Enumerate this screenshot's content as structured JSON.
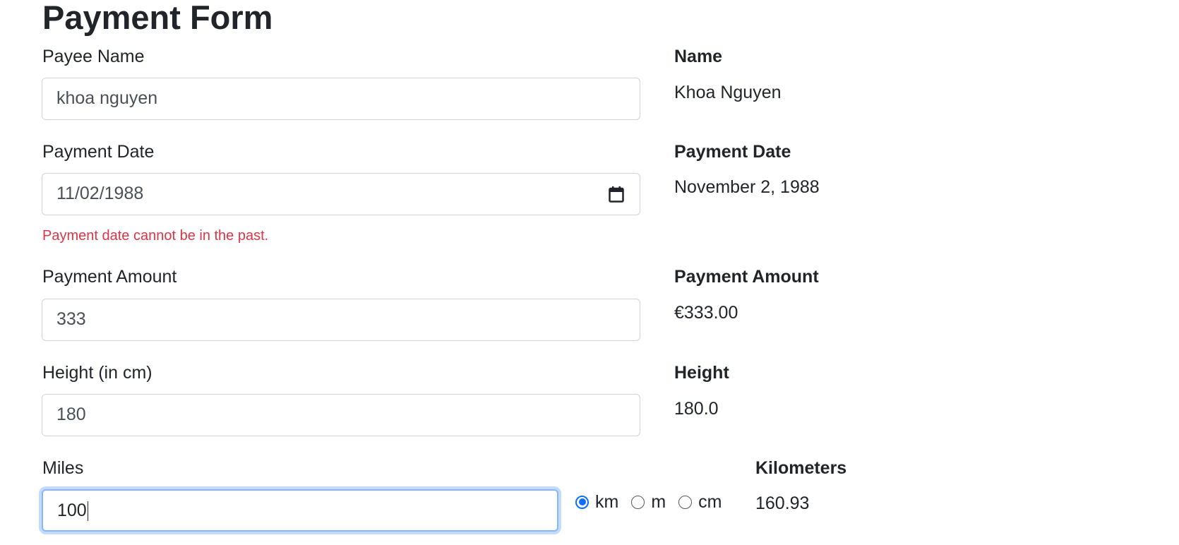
{
  "form": {
    "title": "Payment Form",
    "payee_name": {
      "label": "Payee Name",
      "value": "khoa nguyen"
    },
    "payment_date": {
      "label": "Payment Date",
      "value": "11/02/1988",
      "error": "Payment date cannot be in the past."
    },
    "payment_amount": {
      "label": "Payment Amount",
      "value": "333"
    },
    "height": {
      "label": "Height (in cm)",
      "value": "180"
    },
    "miles": {
      "label": "Miles",
      "value": "100",
      "units": [
        {
          "label": "km",
          "checked": true
        },
        {
          "label": "m",
          "checked": false
        },
        {
          "label": "cm",
          "checked": false
        }
      ]
    }
  },
  "output": {
    "name": {
      "label": "Name",
      "value": "Khoa Nguyen"
    },
    "payment_date": {
      "label": "Payment Date",
      "value": "November 2, 1988"
    },
    "payment_amount": {
      "label": "Payment Amount",
      "value": "€333.00"
    },
    "height": {
      "label": "Height",
      "value": "180.0"
    },
    "kilometers": {
      "label": "Kilometers",
      "value": "160.93"
    }
  },
  "colors": {
    "error": "#dc3545",
    "accent": "#0d6efd",
    "focus_border": "#86b7fe"
  },
  "icons": {
    "date_picker": "calendar-icon"
  }
}
